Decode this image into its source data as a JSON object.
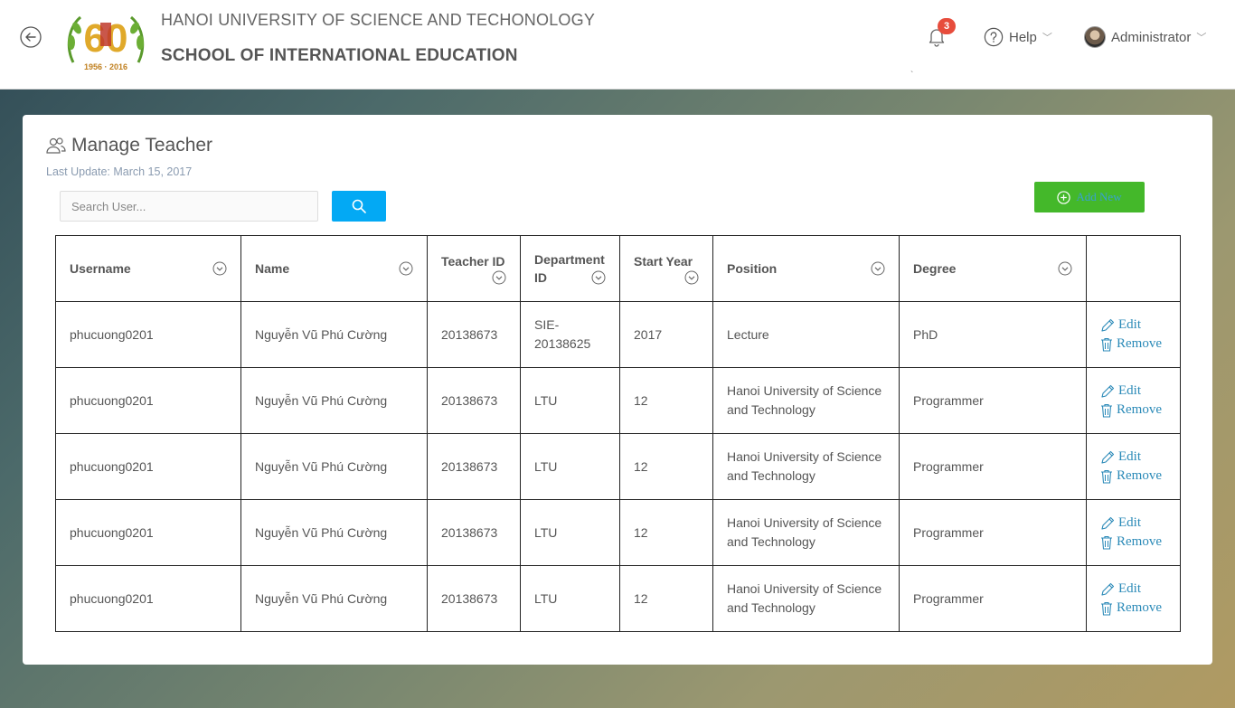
{
  "header": {
    "university": "HANOI UNIVERSITY OF SCIENCE AND TECHONOLOGY",
    "school": "SCHOOL OF INTERNATIONAL EDUCATION",
    "logo_number": "60",
    "logo_years": "1956 · 2016",
    "notifications_count": "3",
    "help_label": "Help",
    "user_label": "Administrator"
  },
  "page": {
    "title": "Manage Teacher",
    "last_update": "Last Update: March 15, 2017",
    "search_placeholder": "Search User...",
    "add_label": "Add New"
  },
  "table": {
    "headers": [
      "Username",
      "Name",
      "Teacher ID",
      "Department ID",
      "Start Year",
      "Position",
      "Degree",
      ""
    ],
    "header_lines": {
      "teacher_id": [
        "Teacher ID"
      ],
      "department_id": [
        "Department",
        "ID"
      ],
      "start_year": [
        "Start Year"
      ]
    },
    "rows": [
      {
        "username": "phucuong0201",
        "name": "Nguyễn Vũ Phú Cường",
        "teacher_id": "20138673",
        "department_l1": "SIE-",
        "department_l2": "20138625",
        "start_year": "2017",
        "position_l1": "Lecture",
        "position_l2": "",
        "degree": "PhD"
      },
      {
        "username": "phucuong0201",
        "name": "Nguyễn Vũ Phú Cường",
        "teacher_id": "20138673",
        "department_l1": "LTU",
        "department_l2": "",
        "start_year": "12",
        "position_l1": "Hanoi University of Science",
        "position_l2": "and Technology",
        "degree": "Programmer"
      },
      {
        "username": "phucuong0201",
        "name": "Nguyễn Vũ Phú Cường",
        "teacher_id": "20138673",
        "department_l1": "LTU",
        "department_l2": "",
        "start_year": "12",
        "position_l1": "Hanoi University of Science",
        "position_l2": "and Technology",
        "degree": "Programmer"
      },
      {
        "username": "phucuong0201",
        "name": "Nguyễn Vũ Phú Cường",
        "teacher_id": "20138673",
        "department_l1": "LTU",
        "department_l2": "",
        "start_year": "12",
        "position_l1": "Hanoi University of Science",
        "position_l2": "and Technology",
        "degree": "Programmer"
      },
      {
        "username": "phucuong0201",
        "name": "Nguyễn Vũ Phú Cường",
        "teacher_id": "20138673",
        "department_l1": "LTU",
        "department_l2": "",
        "start_year": "12",
        "position_l1": "Hanoi University of Science",
        "position_l2": "and Technology",
        "degree": "Programmer"
      }
    ],
    "edit_label": "Edit",
    "remove_label": "Remove"
  },
  "colors": {
    "accent_blue": "#03a9f4",
    "add_green": "#44b82a",
    "badge_red": "#e74c3c",
    "link_blue": "#2b8ab8"
  }
}
